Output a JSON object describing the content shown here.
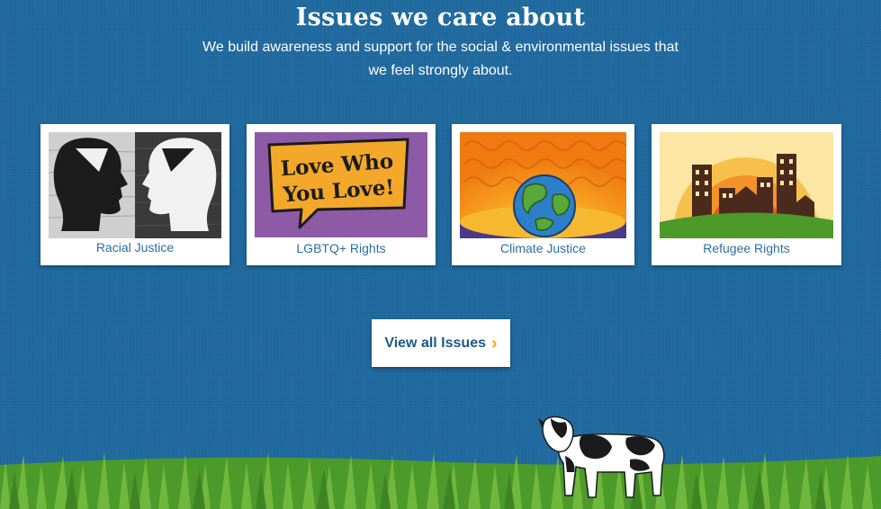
{
  "section": {
    "title": "Issues we care about",
    "subtitle_line1": "We build awareness and support for the social & environmental issues that",
    "subtitle_line2": "we feel strongly about."
  },
  "cards": [
    {
      "label": "Racial Justice",
      "image": "two-crumpled-paper-heads-facing"
    },
    {
      "label": "LGBTQ+ Rights",
      "image": "speech-bubble-love-who-you-love",
      "image_text": "Love Who You Love!"
    },
    {
      "label": "Climate Justice",
      "image": "earth-globe-hot-sun-background"
    },
    {
      "label": "Refugee Rights",
      "image": "city-skyline-sunset"
    }
  ],
  "button": {
    "label": "View all Issues",
    "icon": "chevron-right-icon"
  },
  "colors": {
    "background": "#1f6aa0",
    "link": "#2b6f9e",
    "accent": "#f2a81d",
    "grass": "#4c9a2a"
  }
}
